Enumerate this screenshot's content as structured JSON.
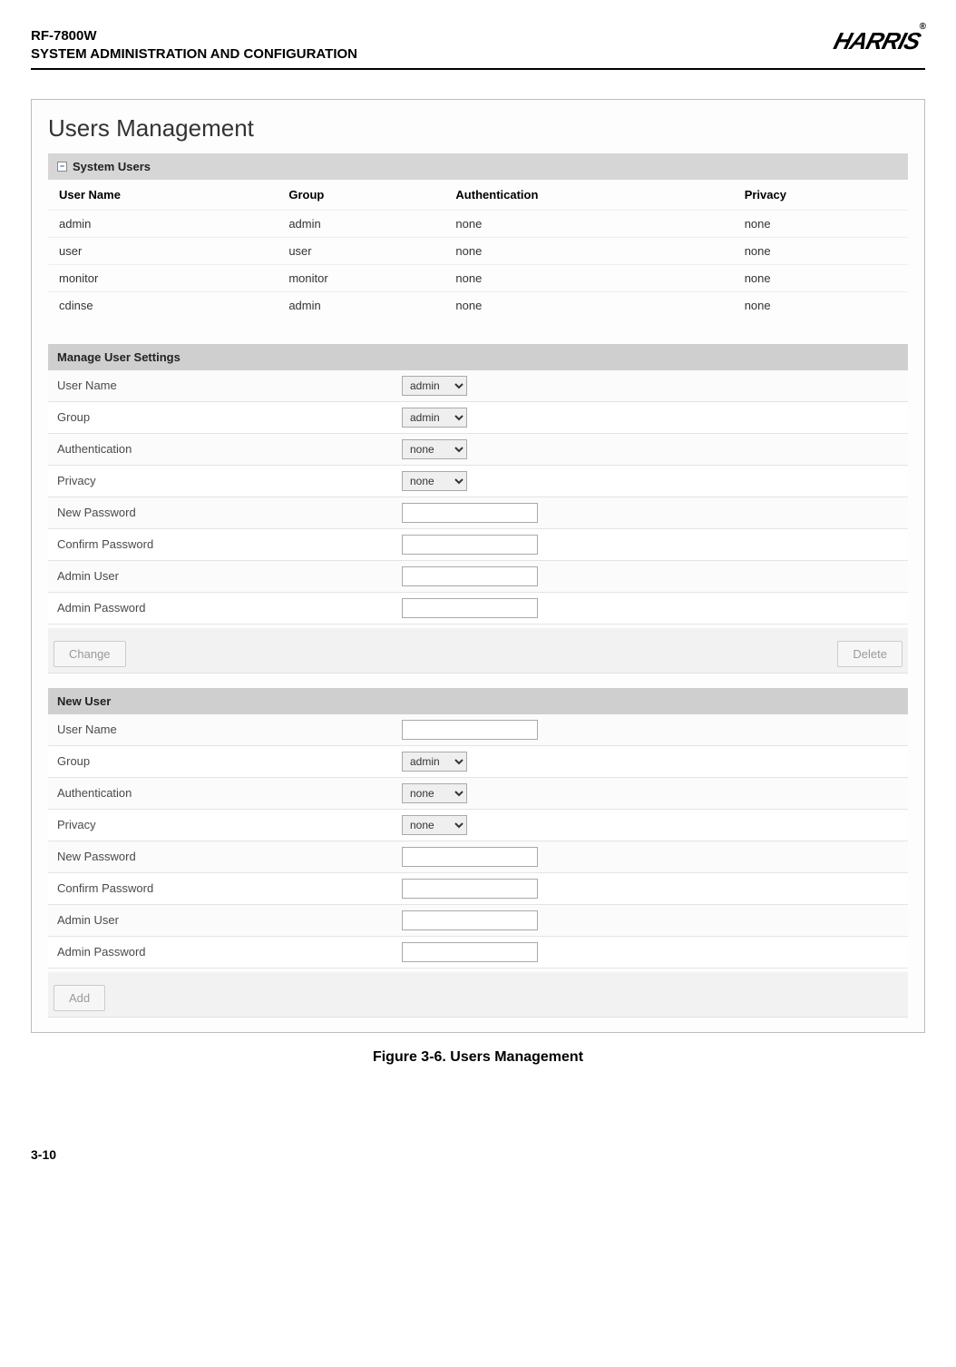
{
  "header": {
    "model": "RF-7800W",
    "section": "SYSTEM ADMINISTRATION AND CONFIGURATION",
    "brand": "HARRIS",
    "reg": "®"
  },
  "panel": {
    "title": "Users Management",
    "system_users_label": "System Users",
    "columns": {
      "c1": "User Name",
      "c2": "Group",
      "c3": "Authentication",
      "c4": "Privacy"
    },
    "rows": [
      {
        "user": "admin",
        "group": "admin",
        "auth": "none",
        "priv": "none"
      },
      {
        "user": "user",
        "group": "user",
        "auth": "none",
        "priv": "none"
      },
      {
        "user": "monitor",
        "group": "monitor",
        "auth": "none",
        "priv": "none"
      },
      {
        "user": "cdinse",
        "group": "admin",
        "auth": "none",
        "priv": "none"
      }
    ],
    "manage": {
      "title": "Manage User Settings",
      "labels": {
        "user": "User Name",
        "group": "Group",
        "auth": "Authentication",
        "priv": "Privacy",
        "newpw": "New Password",
        "confpw": "Confirm Password",
        "admuser": "Admin User",
        "admpw": "Admin Password"
      },
      "values": {
        "user": "admin",
        "group": "admin",
        "auth": "none",
        "priv": "none"
      },
      "buttons": {
        "change": "Change",
        "delete": "Delete"
      }
    },
    "newuser": {
      "title": "New User",
      "labels": {
        "user": "User Name",
        "group": "Group",
        "auth": "Authentication",
        "priv": "Privacy",
        "newpw": "New Password",
        "confpw": "Confirm Password",
        "admuser": "Admin User",
        "admpw": "Admin Password"
      },
      "values": {
        "group": "admin",
        "auth": "none",
        "priv": "none"
      },
      "buttons": {
        "add": "Add"
      }
    }
  },
  "caption": "Figure 3-6.  Users Management",
  "page_number": "3-10",
  "icons": {
    "minus": "−"
  }
}
